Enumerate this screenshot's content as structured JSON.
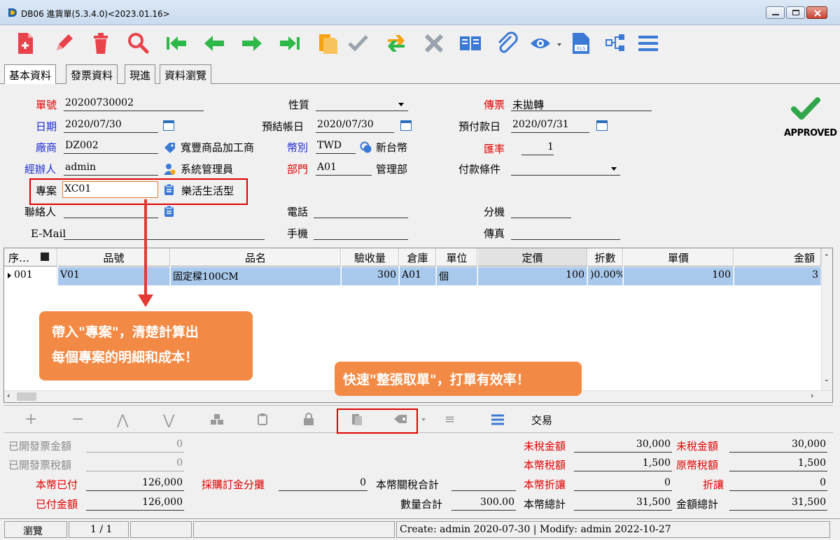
{
  "window": {
    "title": "DB06 進貨單(5.3.4.0)<2023.01.16>"
  },
  "toolbar": {
    "icons": [
      "new-doc",
      "edit",
      "delete",
      "search",
      "first",
      "prev",
      "next",
      "last",
      "copy",
      "confirm",
      "transfer",
      "cancel",
      "view-book",
      "attach",
      "preview",
      "export-xls",
      "tree",
      "menu"
    ]
  },
  "tabs": [
    {
      "label": "基本資料"
    },
    {
      "label": "發票資料"
    },
    {
      "label": "現進"
    },
    {
      "label": "資料瀏覽"
    }
  ],
  "form": {
    "doc_no": {
      "label": "單號",
      "value": "20200730002"
    },
    "date": {
      "label": "日期",
      "value": "2020/07/30"
    },
    "vendor": {
      "label": "廠商",
      "value": "DZ002",
      "name": "寬豐商品加工商"
    },
    "agent": {
      "label": "經辦人",
      "value": "admin",
      "name": "系統管理員"
    },
    "project": {
      "label": "專案",
      "value": "XC01",
      "name": "樂活生活型"
    },
    "contact": {
      "label": "聯絡人",
      "value": ""
    },
    "email": {
      "label": "E-Mail",
      "value": ""
    },
    "nature": {
      "label": "性質",
      "value": ""
    },
    "settle_date": {
      "label": "預結帳日",
      "value": "2020/07/30"
    },
    "currency": {
      "label": "幣別",
      "value": "TWD",
      "name": "新台幣"
    },
    "dept": {
      "label": "部門",
      "value": "A01",
      "name": "管理部"
    },
    "phone": {
      "label": "電話",
      "value": ""
    },
    "mobile": {
      "label": "手機",
      "value": ""
    },
    "voucher": {
      "label": "傳票",
      "value": "未拋轉"
    },
    "prepay_date": {
      "label": "預付款日",
      "value": "2020/07/31"
    },
    "rate": {
      "label": "匯率",
      "value": "1"
    },
    "terms": {
      "label": "付款條件",
      "value": ""
    },
    "ext": {
      "label": "分機",
      "value": ""
    },
    "fax": {
      "label": "傳真",
      "value": ""
    },
    "approved": "APPROVED"
  },
  "grid": {
    "headers": [
      "序…",
      "品號",
      "品名",
      "驗收量",
      "倉庫",
      "單位",
      "定價",
      "折數",
      "單價",
      "金額"
    ],
    "rows": [
      [
        "001",
        "V01",
        "固定樑100CM",
        "300",
        "A01",
        "個",
        "100",
        ")0.00%",
        "100",
        "3"
      ]
    ]
  },
  "callouts": {
    "project": [
      "帶入\"專案\"，清楚計算出",
      "每個專案的明細和成本！"
    ],
    "whole": "快速\"整張取單\"，打單有效率！"
  },
  "bottom_toolbar": {
    "trade_label": "交易"
  },
  "summary": {
    "inv_amount": {
      "label": "已開發票金額",
      "value": "0"
    },
    "inv_tax": {
      "label": "已開發票稅額",
      "value": "0"
    },
    "paid_local": {
      "label": "本幣已付",
      "value": "126,000"
    },
    "paid_amount": {
      "label": "已付金額",
      "value": "126,000"
    },
    "po_deposit": {
      "label": "採購訂金分攤",
      "value": "0"
    },
    "customs_total": {
      "label": "本幣關稅合計",
      "value": ""
    },
    "qty_total": {
      "label": "數量合計",
      "value": "300.00"
    },
    "untaxed": {
      "label": "未稅金額",
      "value": "30,000"
    },
    "local_tax": {
      "label": "本幣稅額",
      "value": "1,500"
    },
    "local_discount": {
      "label": "本幣折讓",
      "value": "0"
    },
    "local_total": {
      "label": "本幣總計",
      "value": "31,500"
    },
    "untaxed2": {
      "label": "未稅金額",
      "value": "30,000"
    },
    "orig_tax": {
      "label": "原幣稅額",
      "value": "1,500"
    },
    "discount": {
      "label": "折讓",
      "value": "0"
    },
    "grand_total": {
      "label": "金額總計",
      "value": "31,500"
    }
  },
  "status": {
    "mode": "瀏覽",
    "page": "1 / 1",
    "info": "Create: admin 2020-07-30 | Modify: admin 2022-10-27"
  },
  "colors": {
    "red": "#e00000",
    "blue": "#1d2ad0",
    "accent": "#f28a45",
    "highlight": "#a9c9ec",
    "icon_red": "#e8424a",
    "icon_green": "#2fb84a"
  }
}
